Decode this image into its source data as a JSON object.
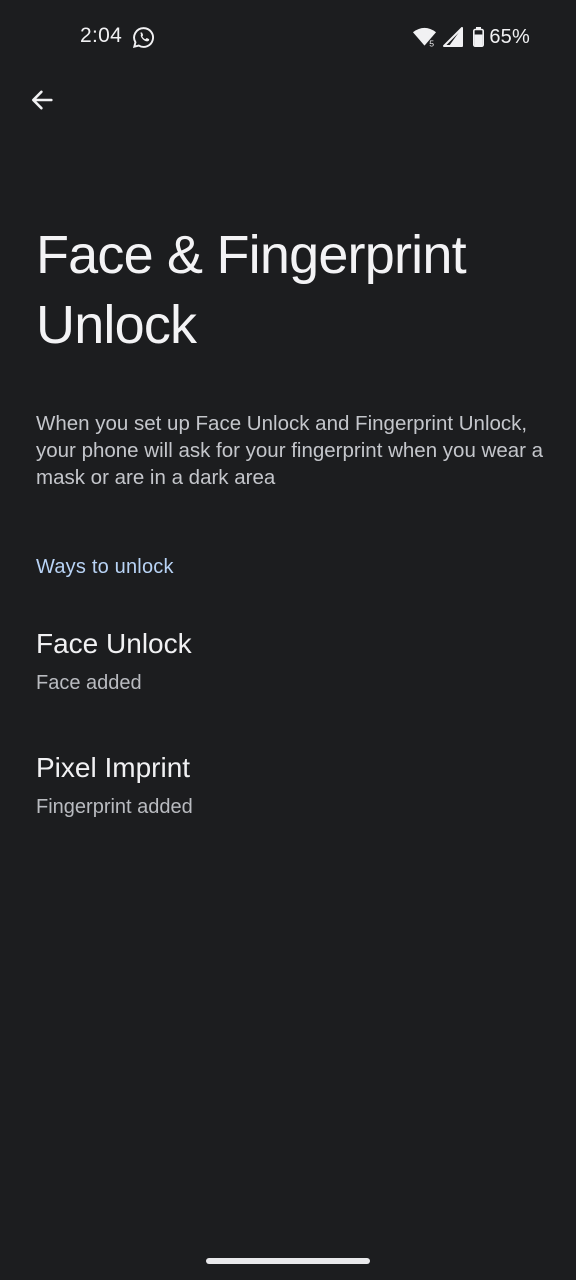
{
  "status_bar": {
    "time": "2:04",
    "battery": "65%",
    "wifi_badge": "5"
  },
  "header": {
    "back_label": "Back"
  },
  "page": {
    "title": "Face & Fingerprint Unlock",
    "description": "When you set up Face Unlock and Fingerprint Unlock, your phone will ask for your fingerprint when you wear a mask or are in a dark area",
    "section_header": "Ways to unlock",
    "items": [
      {
        "title": "Face Unlock",
        "subtitle": "Face added"
      },
      {
        "title": "Pixel Imprint",
        "subtitle": "Fingerprint added"
      }
    ]
  },
  "colors": {
    "background": "#1c1d1f",
    "accent": "#b8d3f5"
  }
}
